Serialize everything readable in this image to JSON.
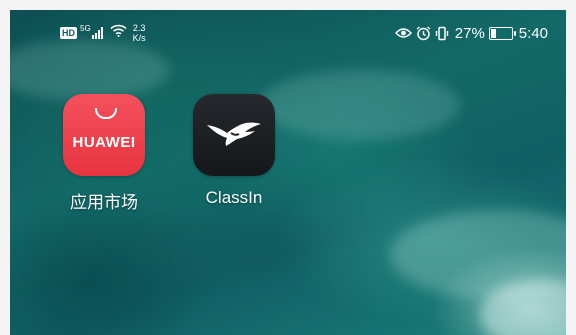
{
  "status_bar": {
    "hd_label": "HD",
    "network_label": "5G",
    "speed_value": "2.3",
    "speed_unit": "K/s",
    "battery_percent": "27%",
    "battery_level": 0.27,
    "time": "5:40",
    "icons": [
      "signal-icon",
      "wifi-icon",
      "eye-icon",
      "alarm-icon",
      "vibrate-icon",
      "battery-icon"
    ]
  },
  "apps": [
    {
      "label": "应用市场",
      "icon_text": "HUAWEI",
      "icon": "huawei-appgallery-icon",
      "color": "#ee3e4a"
    },
    {
      "label": "ClassIn",
      "icon": "classin-icon",
      "color": "#1f2226"
    }
  ]
}
